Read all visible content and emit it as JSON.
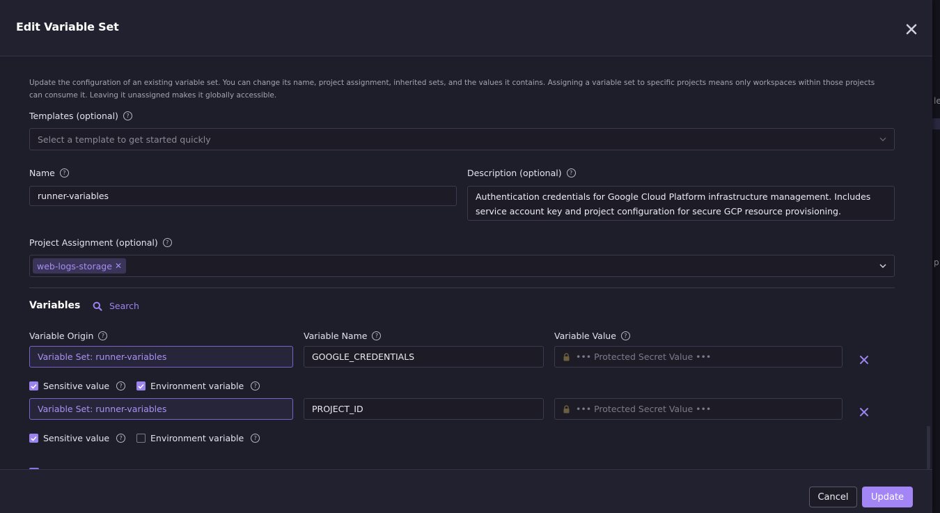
{
  "modal": {
    "title": "Edit Variable Set",
    "intro": "Update the configuration of an existing variable set. You can change its name, project assignment, inherited sets, and the values it contains. Assigning a variable set to specific projects means only workspaces within those projects can consume it. Leaving it unassigned makes it globally accessible."
  },
  "templates": {
    "label": "Templates (optional)",
    "placeholder": "Select a template to get started quickly"
  },
  "name": {
    "label": "Name",
    "value": "runner-variables"
  },
  "description": {
    "label": "Description (optional)",
    "value": "Authentication credentials for Google Cloud Platform infrastructure management. Includes service account key and project configuration for secure GCP resource provisioning."
  },
  "project_assignment": {
    "label": "Project Assignment (optional)",
    "tags": [
      {
        "label": "web-logs-storage"
      }
    ]
  },
  "variables": {
    "title": "Variables",
    "search_label": "Search",
    "col_origin": "Variable Origin",
    "col_name": "Variable Name",
    "col_value": "Variable Value",
    "rows": [
      {
        "origin": "Variable Set: runner-variables",
        "name": "GOOGLE_CREDENTIALS",
        "value_placeholder": "••• Protected Secret Value •••",
        "sensitive_label": "Sensitive value",
        "sensitive": true,
        "env_label": "Environment variable",
        "env": true
      },
      {
        "origin": "Variable Set: runner-variables",
        "name": "PROJECT_ID",
        "value_placeholder": "••• Protected Secret Value •••",
        "sensitive_label": "Sensitive value",
        "sensitive": true,
        "env_label": "Environment variable",
        "env": false
      }
    ]
  },
  "footer": {
    "cancel_label": "Cancel",
    "update_label": "Update"
  },
  "background": {
    "text_1": "les",
    "text_2": "p"
  },
  "colors": {
    "accent": "#a385f5",
    "modal_bg": "#1e1d2a",
    "header_bg": "#22212f",
    "origin_text": "#a993f2"
  },
  "icons": {
    "close": "close-icon",
    "help": "help-circle-icon",
    "chevron": "chevron-down-icon",
    "search": "search-icon",
    "lock": "lock-icon",
    "remove": "x-icon",
    "check": "check-icon"
  }
}
